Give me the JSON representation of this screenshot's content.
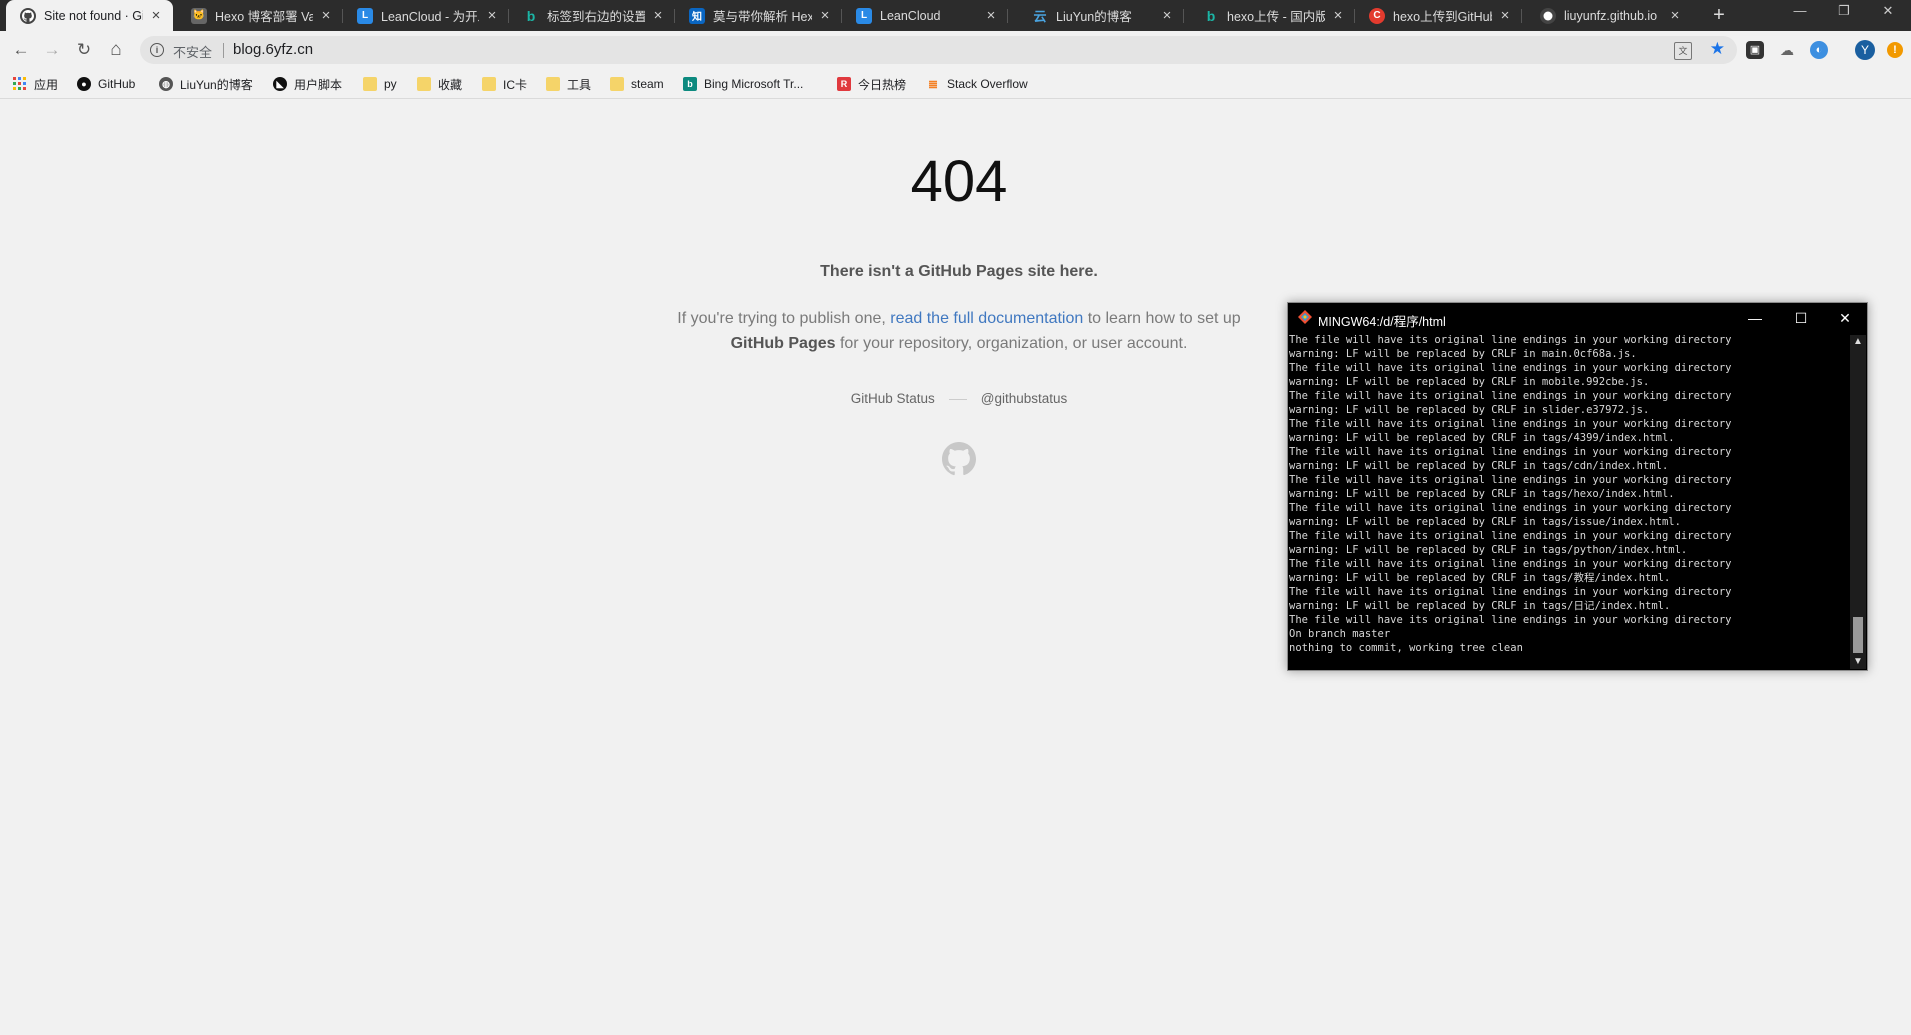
{
  "tabs": [
    {
      "title": "Site not found · GitHub Pages",
      "favicon": "github",
      "active": true
    },
    {
      "title": "Hexo 博客部署 Valine",
      "favicon": "cat"
    },
    {
      "title": "LeanCloud - 为开发者",
      "favicon": "L"
    },
    {
      "title": "标签到右边的设置",
      "favicon": "b"
    },
    {
      "title": "莫与带你解析 Hexo",
      "favicon": "知"
    },
    {
      "title": "LeanCloud",
      "favicon": "L"
    },
    {
      "title": "LiuYun的博客",
      "favicon": "云"
    },
    {
      "title": "hexo上传 - 国内版",
      "favicon": "b"
    },
    {
      "title": "hexo上传到GitHub",
      "favicon": "C"
    },
    {
      "title": "liuyunfz.github.io",
      "favicon": "github"
    }
  ],
  "window_controls": {
    "minimize": "—",
    "restore": "❐",
    "close": "✕"
  },
  "toolbar": {
    "back": "←",
    "forward": "→",
    "reload": "↻",
    "home": "⌂",
    "security_label": "不安全",
    "url": "blog.6yfz.cn",
    "star": "★",
    "profile_initial": "Y",
    "update": "!"
  },
  "bookmarks": [
    {
      "label": "应用",
      "icon": "apps-grid-icon"
    },
    {
      "label": "GitHub",
      "icon": "github-icon"
    },
    {
      "label": "LiuYun的博客",
      "icon": "globe-icon"
    },
    {
      "label": "用户脚本",
      "icon": "script-icon"
    },
    {
      "label": "py",
      "icon": "folder-icon"
    },
    {
      "label": "收藏",
      "icon": "folder-icon"
    },
    {
      "label": "IC卡",
      "icon": "folder-icon"
    },
    {
      "label": "工具",
      "icon": "folder-icon"
    },
    {
      "label": "steam",
      "icon": "folder-icon"
    },
    {
      "label": "Bing Microsoft Tr...",
      "icon": "bing-icon"
    },
    {
      "label": "今日热榜",
      "icon": "r-icon"
    },
    {
      "label": "Stack Overflow",
      "icon": "stackoverflow-icon"
    }
  ],
  "page": {
    "code": "404",
    "headline": "There isn't a GitHub Pages site here.",
    "desc_prefix": "If you're trying to publish one, ",
    "desc_link": "read the full documentation",
    "desc_middle": " to learn how to set up ",
    "desc_bold": "GitHub Pages",
    "desc_suffix": " for your repository, organization, or user account.",
    "status_link": "GitHub Status",
    "twitter_link": "@githubstatus"
  },
  "terminal": {
    "title": "MINGW64:/d/程序/html",
    "lines": [
      "The file will have its original line endings in your working directory",
      "warning: LF will be replaced by CRLF in main.0cf68a.js.",
      "The file will have its original line endings in your working directory",
      "warning: LF will be replaced by CRLF in mobile.992cbe.js.",
      "The file will have its original line endings in your working directory",
      "warning: LF will be replaced by CRLF in slider.e37972.js.",
      "The file will have its original line endings in your working directory",
      "warning: LF will be replaced by CRLF in tags/4399/index.html.",
      "The file will have its original line endings in your working directory",
      "warning: LF will be replaced by CRLF in tags/cdn/index.html.",
      "The file will have its original line endings in your working directory",
      "warning: LF will be replaced by CRLF in tags/hexo/index.html.",
      "The file will have its original line endings in your working directory",
      "warning: LF will be replaced by CRLF in tags/issue/index.html.",
      "The file will have its original line endings in your working directory",
      "warning: LF will be replaced by CRLF in tags/python/index.html.",
      "The file will have its original line endings in your working directory",
      "warning: LF will be replaced by CRLF in tags/教程/index.html.",
      "The file will have its original line endings in your working directory",
      "warning: LF will be replaced by CRLF in tags/日记/index.html.",
      "The file will have its original line endings in your working directory",
      "On branch master",
      "nothing to commit, working tree clean"
    ]
  },
  "colors": {
    "tabstrip": "#2c2c2c",
    "page_bg": "#f1f1f1",
    "link": "#4078c0",
    "terminal_bg": "#000000"
  }
}
